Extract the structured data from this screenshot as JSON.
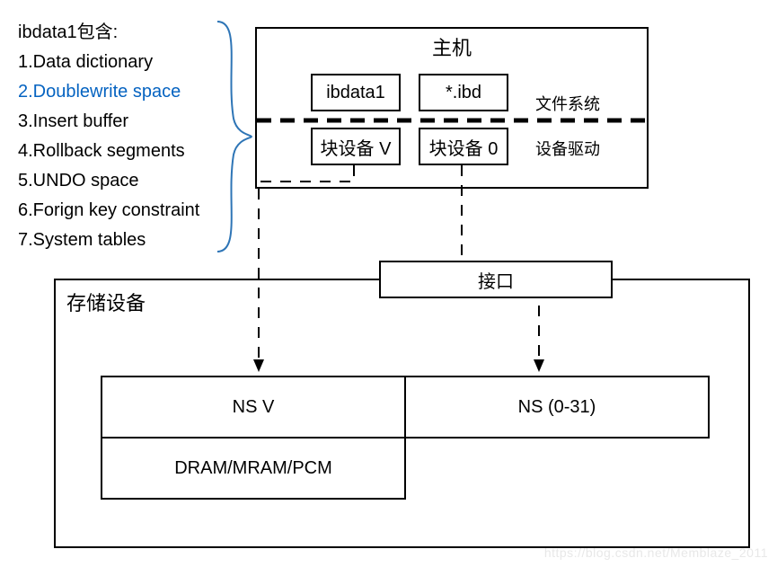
{
  "list": {
    "title": "ibdata1包含:",
    "items": [
      "1.Data dictionary",
      "2.Doublewrite space",
      "3.Insert buffer",
      "4.Rollback segments",
      "5.UNDO space",
      "6.Forign key constraint",
      "7.System tables"
    ],
    "highlight_index": 1
  },
  "host": {
    "title": "主机",
    "box1_top": "ibdata1",
    "box1_bottom": "块设备 V",
    "box2_top": "*.ibd",
    "box2_bottom": "块设备 0",
    "label_fs": "文件系统",
    "label_driver": "设备驱动"
  },
  "storage": {
    "title": "存储设备",
    "interface": "接口",
    "ns_v": "NS V",
    "ns_031": "NS (0-31)",
    "mem": "DRAM/MRAM/PCM"
  },
  "watermark": "https://blog.csdn.net/Memblaze_2011"
}
